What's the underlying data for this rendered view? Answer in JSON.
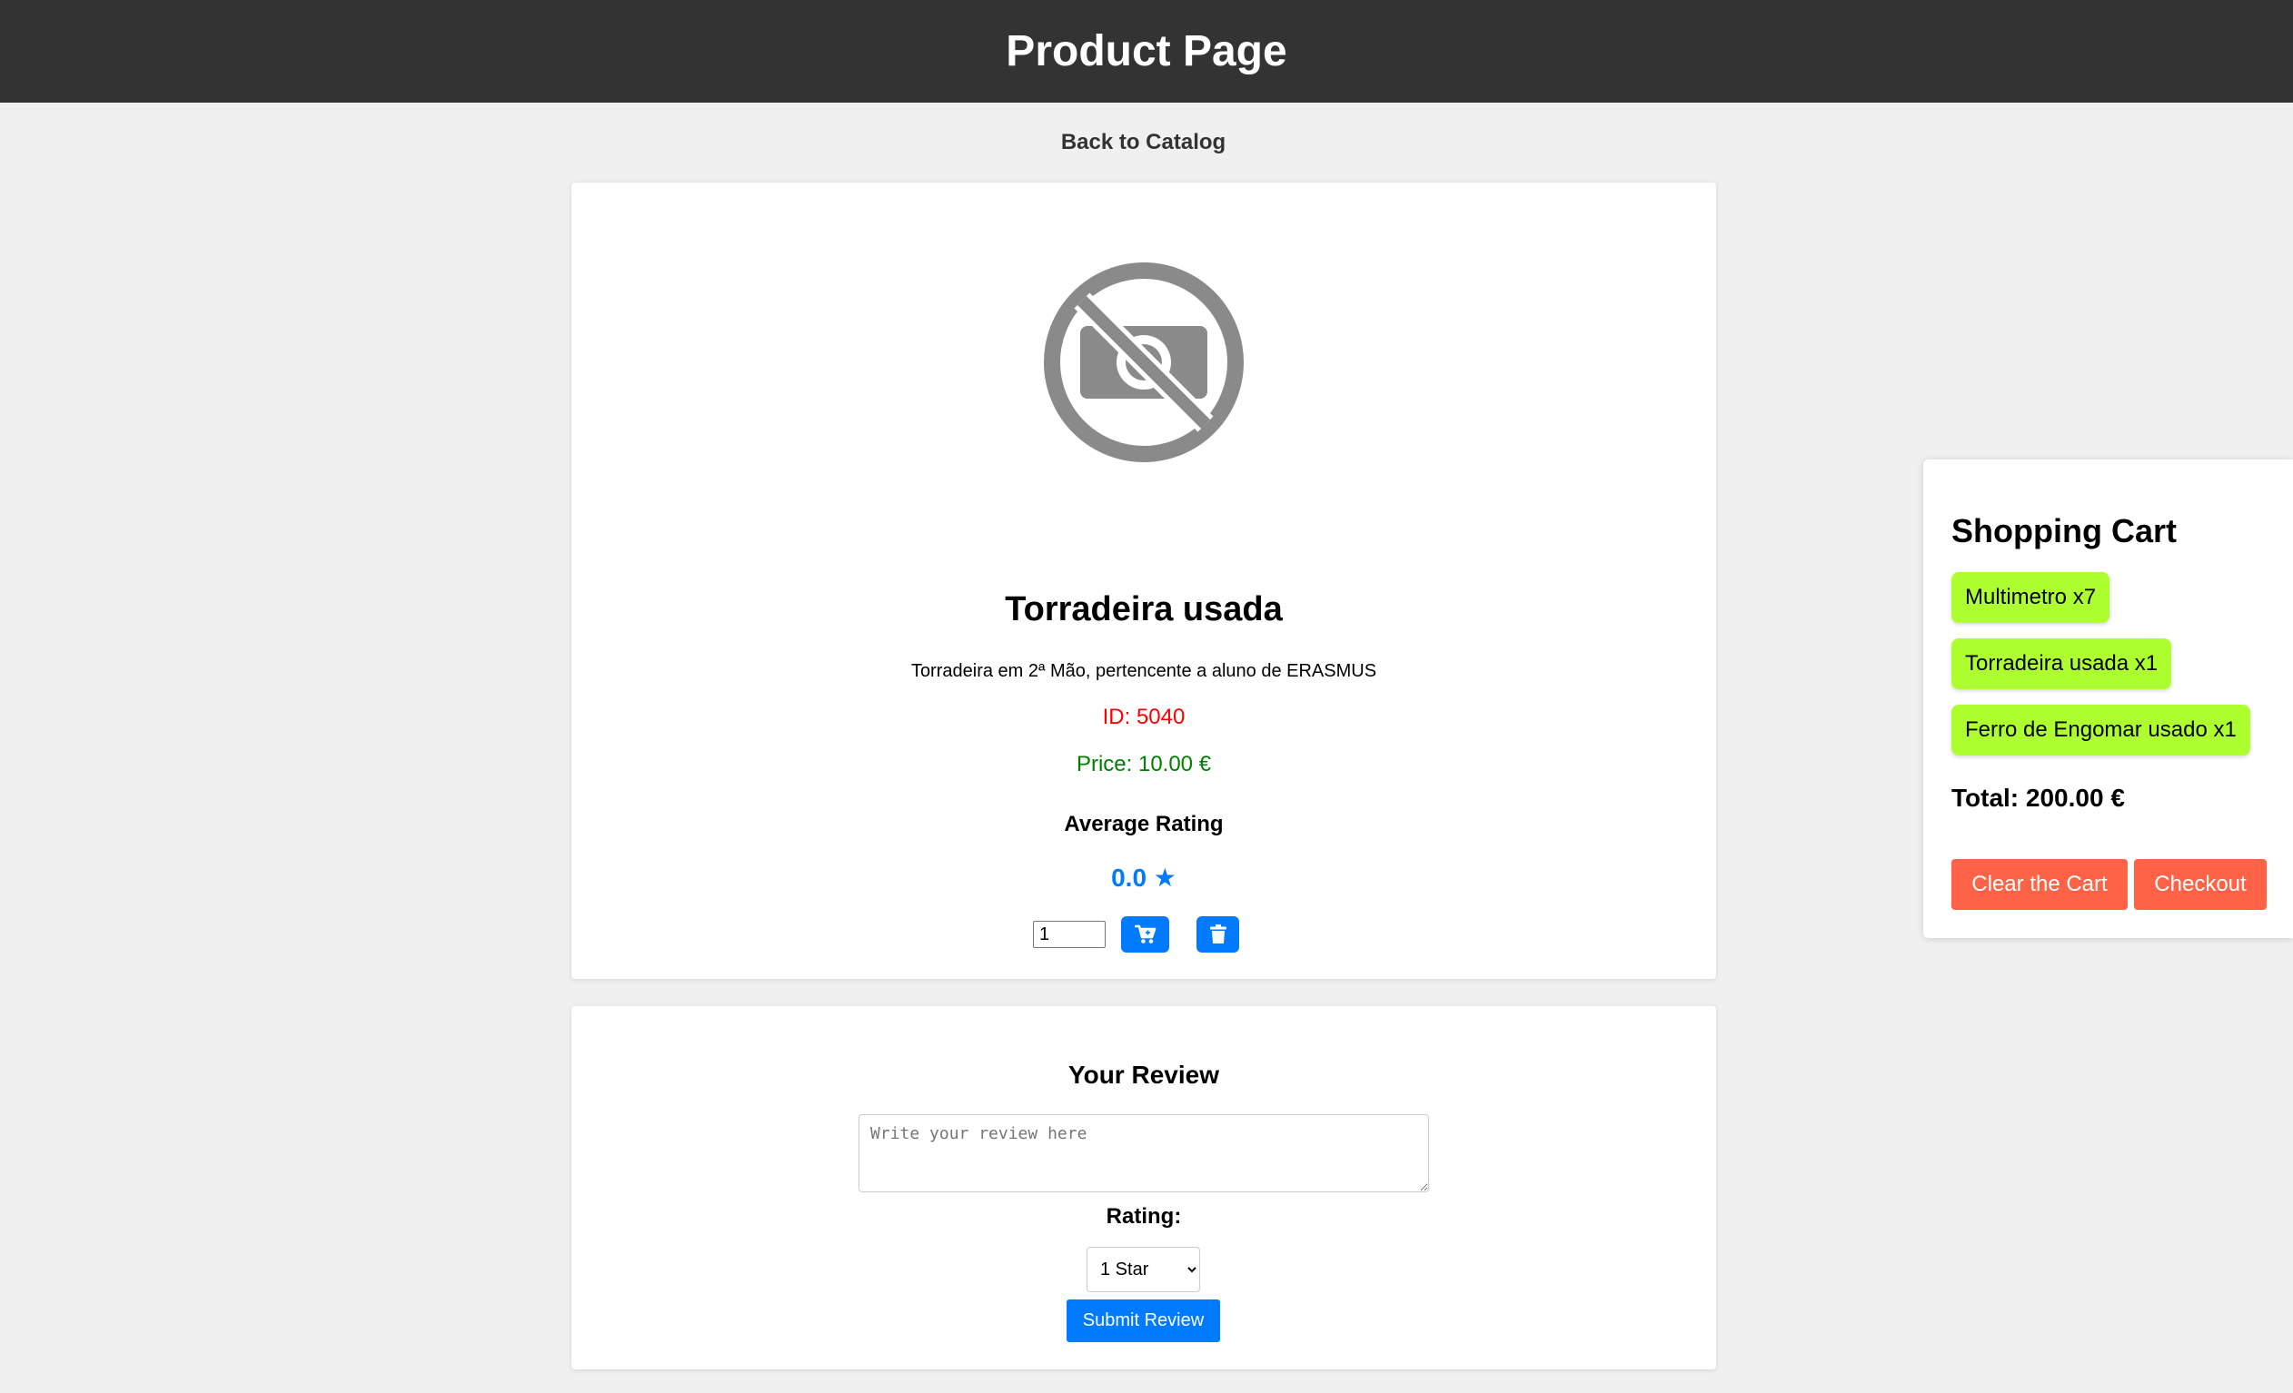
{
  "header": {
    "title": "Product Page"
  },
  "nav": {
    "back_label": "Back to Catalog"
  },
  "product": {
    "image_icon": "no-photo-icon",
    "name": "Torradeira usada",
    "description": "Torradeira em 2ª Mão, pertencente a aluno de ERASMUS",
    "id_text": "ID: 5040",
    "price_text": "Price: 10.00 €",
    "average_rating_label": "Average Rating",
    "average_rating_value": "0.0 ★",
    "quantity_value": "1",
    "add_to_cart_icon": "cart-plus-icon",
    "remove_icon": "trash-icon"
  },
  "review": {
    "title": "Your Review",
    "placeholder": "Write your review here",
    "rating_label": "Rating:",
    "rating_selected": "1 Star",
    "submit_label": "Submit Review"
  },
  "cart": {
    "title": "Shopping Cart",
    "items": [
      {
        "label": "Multimetro x7"
      },
      {
        "label": "Torradeira usada x1"
      },
      {
        "label": "Ferro de Engomar usado x1"
      }
    ],
    "total_text": "Total: 200.00 €",
    "clear_label": "Clear the Cart",
    "checkout_label": "Checkout"
  },
  "colors": {
    "header_bg": "#333333",
    "accent_blue": "#007bff",
    "id_red": "#ff0000",
    "price_green": "#008000",
    "cart_item_bg": "#adff2f",
    "cart_button_bg": "#ff6347"
  }
}
